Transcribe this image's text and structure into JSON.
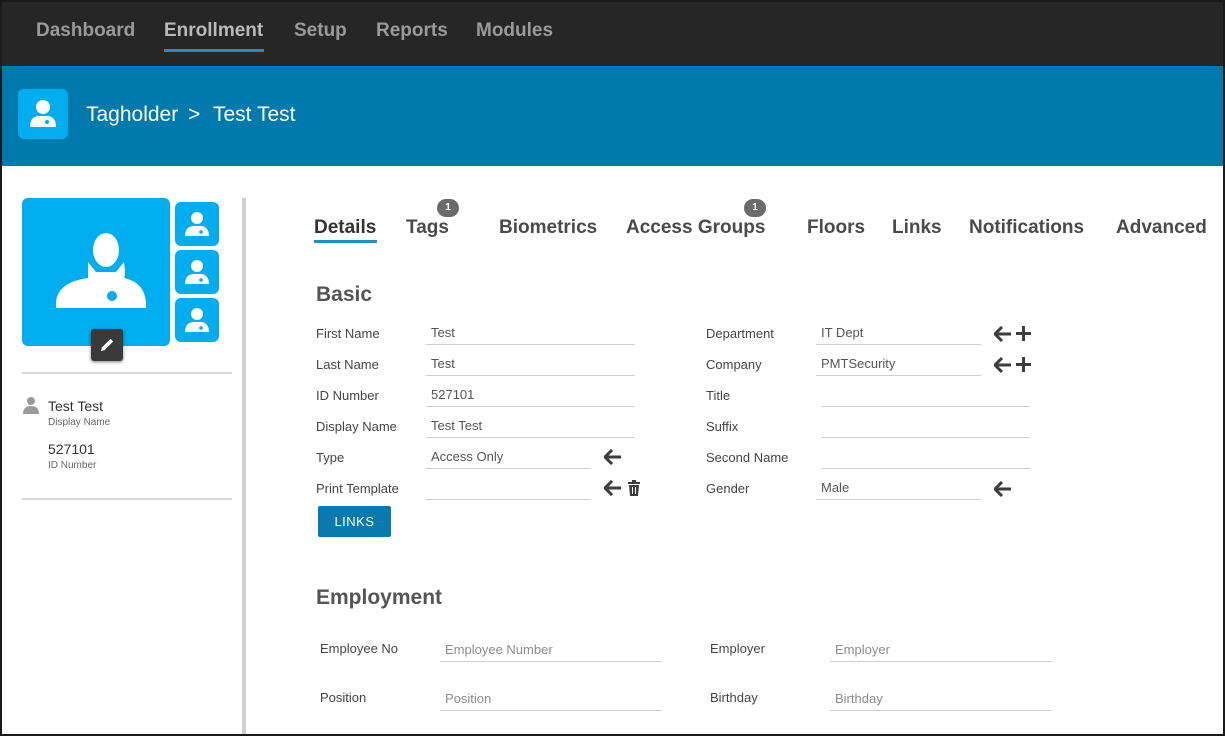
{
  "nav": {
    "items": [
      "Dashboard",
      "Enrollment",
      "Setup",
      "Reports",
      "Modules"
    ],
    "active": "Enrollment"
  },
  "header": {
    "section": "Tagholder",
    "separator": ">",
    "record": "Test Test"
  },
  "summary": {
    "name": "Test Test",
    "name_caption": "Display Name",
    "id": "527101",
    "id_caption": "ID Number"
  },
  "tabs": [
    {
      "label": "Details"
    },
    {
      "label": "Tags",
      "badge": "1"
    },
    {
      "label": "Biometrics"
    },
    {
      "label": "Access Groups",
      "badge": "1"
    },
    {
      "label": "Floors"
    },
    {
      "label": "Links"
    },
    {
      "label": "Notifications"
    },
    {
      "label": "Advanced"
    }
  ],
  "basic": {
    "title": "Basic",
    "left": [
      {
        "label": "First Name",
        "value": "Test"
      },
      {
        "label": "Last Name",
        "value": "Test"
      },
      {
        "label": "ID Number",
        "value": "527101"
      },
      {
        "label": "Display Name",
        "value": "Test Test"
      },
      {
        "label": "Type",
        "value": "Access Only"
      },
      {
        "label": "Print Template",
        "value": ""
      }
    ],
    "right": [
      {
        "label": "Department",
        "value": "IT Dept"
      },
      {
        "label": "Company",
        "value": "PMTSecurity"
      },
      {
        "label": "Title",
        "value": ""
      },
      {
        "label": "Suffix",
        "value": ""
      },
      {
        "label": "Second Name",
        "value": ""
      },
      {
        "label": "Gender",
        "value": "Male"
      }
    ],
    "links_button": "LINKS"
  },
  "employment": {
    "title": "Employment",
    "fields": [
      {
        "label": "Employee No",
        "placeholder": "Employee Number"
      },
      {
        "label": "Employer",
        "placeholder": "Employer"
      },
      {
        "label": "Position",
        "placeholder": "Position"
      },
      {
        "label": "Birthday",
        "placeholder": "Birthday"
      }
    ]
  },
  "icons": {
    "person": "person-icon",
    "edit": "pencil-icon",
    "arrow": "arrow-left-icon",
    "add": "plus-icon",
    "delete": "trash-icon"
  },
  "colors": {
    "topnav": "#262626",
    "header": "#0079ad",
    "accent": "#00adef",
    "button": "#0a79ad"
  }
}
